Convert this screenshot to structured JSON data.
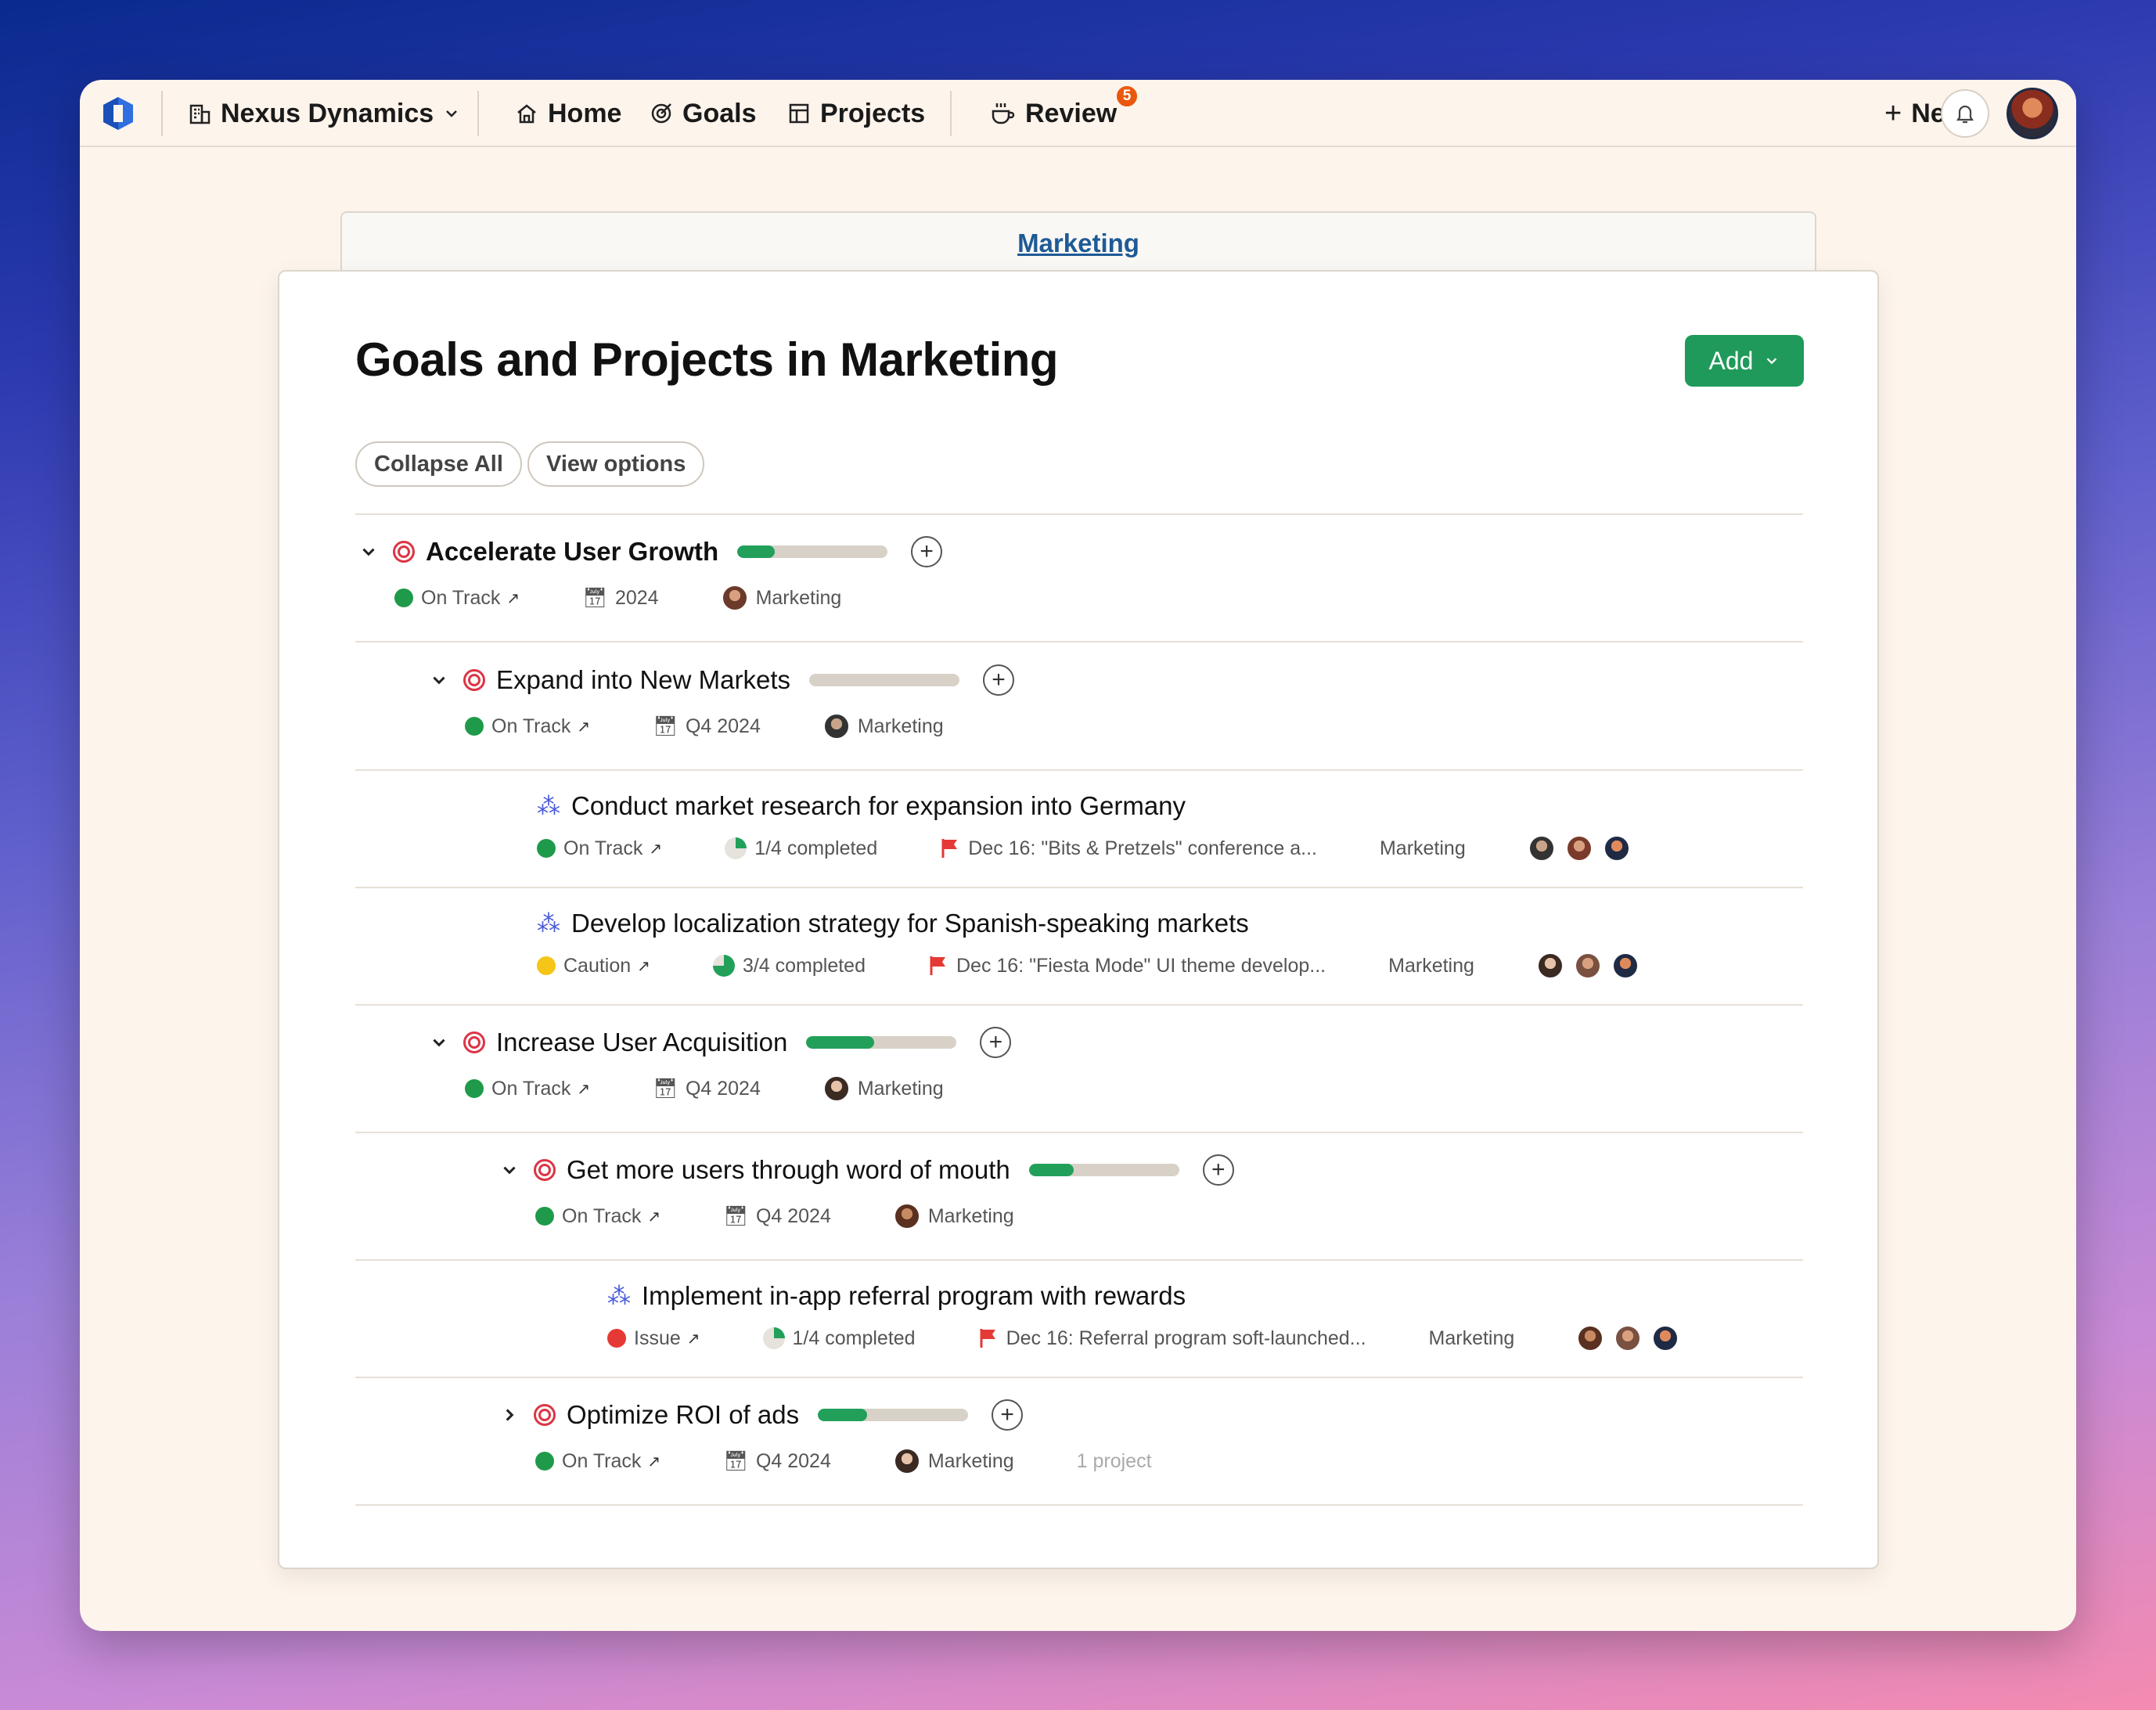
{
  "nav": {
    "org": "Nexus Dynamics",
    "home": "Home",
    "goals": "Goals",
    "projects": "Projects",
    "review": "Review",
    "review_badge": "5",
    "new_label": "New"
  },
  "breadcrumb": "Marketing",
  "page": {
    "title": "Goals and Projects in Marketing",
    "add_label": "Add",
    "collapse_all": "Collapse All",
    "view_options": "View options"
  },
  "items": [
    {
      "kind": "goal",
      "title": "Accelerate User Growth",
      "progress": 0.25,
      "status": "On Track",
      "status_color": "#1f9a4a",
      "period": "2024",
      "team": "Marketing"
    },
    {
      "kind": "goal",
      "title": "Expand into New Markets",
      "progress": 0.0,
      "status": "On Track",
      "status_color": "#1f9a4a",
      "period": "Q4 2024",
      "team": "Marketing"
    },
    {
      "kind": "project",
      "title": "Conduct market research for expansion into Germany",
      "status": "On Track",
      "status_color": "#1f9a4a",
      "completed": "1/4 completed",
      "milestone": "Dec 16: \"Bits & Pretzels\" conference a...",
      "team": "Marketing"
    },
    {
      "kind": "project",
      "title": "Develop localization strategy for Spanish-speaking markets",
      "status": "Caution",
      "status_color": "#f5c518",
      "completed": "3/4 completed",
      "milestone": "Dec 16: \"Fiesta Mode\" UI theme develop...",
      "team": "Marketing"
    },
    {
      "kind": "goal",
      "title": "Increase User Acquisition",
      "progress": 0.45,
      "status": "On Track",
      "status_color": "#1f9a4a",
      "period": "Q4 2024",
      "team": "Marketing"
    },
    {
      "kind": "goal",
      "title": "Get more users through word of mouth",
      "progress": 0.3,
      "status": "On Track",
      "status_color": "#1f9a4a",
      "period": "Q4 2024",
      "team": "Marketing"
    },
    {
      "kind": "project",
      "title": "Implement in-app referral program with rewards",
      "status": "Issue",
      "status_color": "#e53935",
      "completed": "1/4 completed",
      "milestone": "Dec 16: Referral program soft-launched...",
      "team": "Marketing"
    },
    {
      "kind": "goal",
      "title": "Optimize ROI of ads",
      "progress": 0.33,
      "status": "On Track",
      "status_color": "#1f9a4a",
      "period": "Q4 2024",
      "team": "Marketing",
      "extra": "1 project"
    }
  ]
}
